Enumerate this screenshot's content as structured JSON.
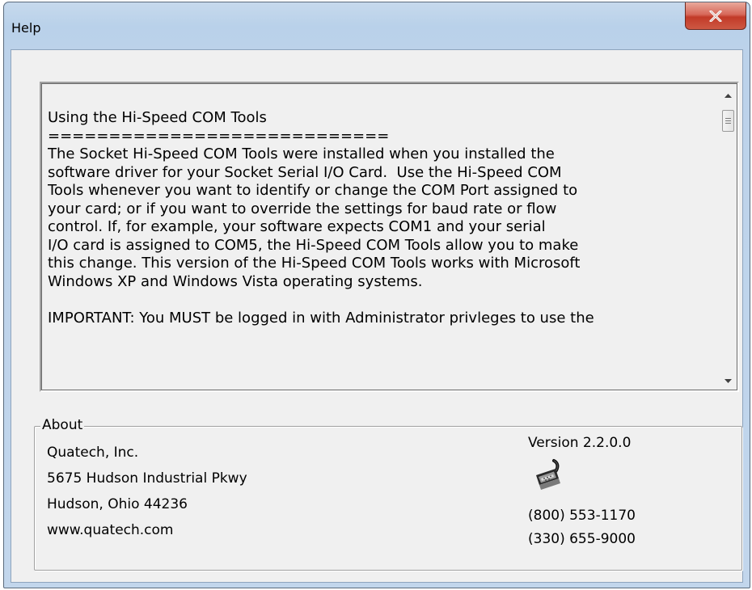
{
  "window": {
    "title": "Help",
    "close_label": "X"
  },
  "help_text": {
    "lines": [
      "Using the Hi-Speed COM Tools",
      "============================",
      "The Socket Hi-Speed COM Tools were installed when you installed the",
      "software driver for your Socket Serial I/O Card.  Use the Hi-Speed COM",
      "Tools whenever you want to identify or change the COM Port assigned to",
      "your card; or if you want to override the settings for baud rate or flow",
      "control. If, for example, your software expects COM1 and your serial",
      "I/O card is assigned to COM5, the Hi-Speed COM Tools allow you to make",
      "this change. This version of the Hi-Speed COM Tools works with Microsoft",
      "Windows XP and Windows Vista operating systems.",
      "",
      "IMPORTANT: You MUST be logged in with Administrator privleges to use the"
    ]
  },
  "about": {
    "legend": "About",
    "company": "Quatech, Inc.",
    "street": "5675 Hudson Industrial Pkwy",
    "city": "Hudson, Ohio 44236",
    "website": "www.quatech.com",
    "version": "Version 2.2.0.0",
    "phone1": "(800) 553-1170",
    "phone2": "(330) 655-9000",
    "icon": "serial-connector-icon"
  },
  "colors": {
    "title_bar": "#b9d1ea",
    "close_button": "#c7432f",
    "dialog_background": "#f0f0f0"
  }
}
